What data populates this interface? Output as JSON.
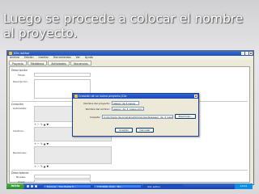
{
  "slide": {
    "title": "Luego se procede a colocar el nombre al proyecto."
  },
  "window": {
    "title": "JClic author",
    "menu": [
      "Archivo",
      "Edición",
      "Insertar",
      "Herramientas",
      "Ver",
      "Ayuda"
    ],
    "tabs": [
      "Proyecto",
      "Mediateca",
      "Actividades",
      "Secuencias"
    ],
    "sections": {
      "descripcion": {
        "header": "Descripción",
        "title_label": "Título:",
        "desc_label": "Descripción:"
      },
      "creacion": {
        "header": "Creación",
        "autores_label": "Autores/as:",
        "centros_label": "Centro/s:",
        "revisiones_label": "Revisiones:"
      },
      "descriptores": {
        "header": "Descriptores",
        "niveles_label": "Niveles:",
        "areas_label": "Áreas:"
      }
    },
    "dialog": {
      "title": "Creación de un nuevo proyecto JClic",
      "name_label": "Nombre del proyecto:",
      "name_value": "asesor de 4 pasos",
      "file_label": "Nombre del archivo:",
      "file_value": "asesor_de_4_pasos.jclic.zip",
      "folder_label": "Carpeta:",
      "folder_value": "C:\\Archivos de programa\\JClic\\projects\\asesor_de_4_pasos",
      "browse_label": "Examinar...",
      "ok_label": "Aceptar",
      "cancel_label": "Cancelar"
    }
  },
  "taskbar": {
    "start_label": "inicio",
    "items": [
      "Explorer - The Mozilla Fi...",
      "TUTORIAL JCLIC - Mic...",
      "JClic author"
    ],
    "clock": "10:21"
  },
  "colors": {
    "titlebar": "#1e4fb8",
    "taskbar": "#1941a5",
    "start": "#2f8a2f"
  }
}
